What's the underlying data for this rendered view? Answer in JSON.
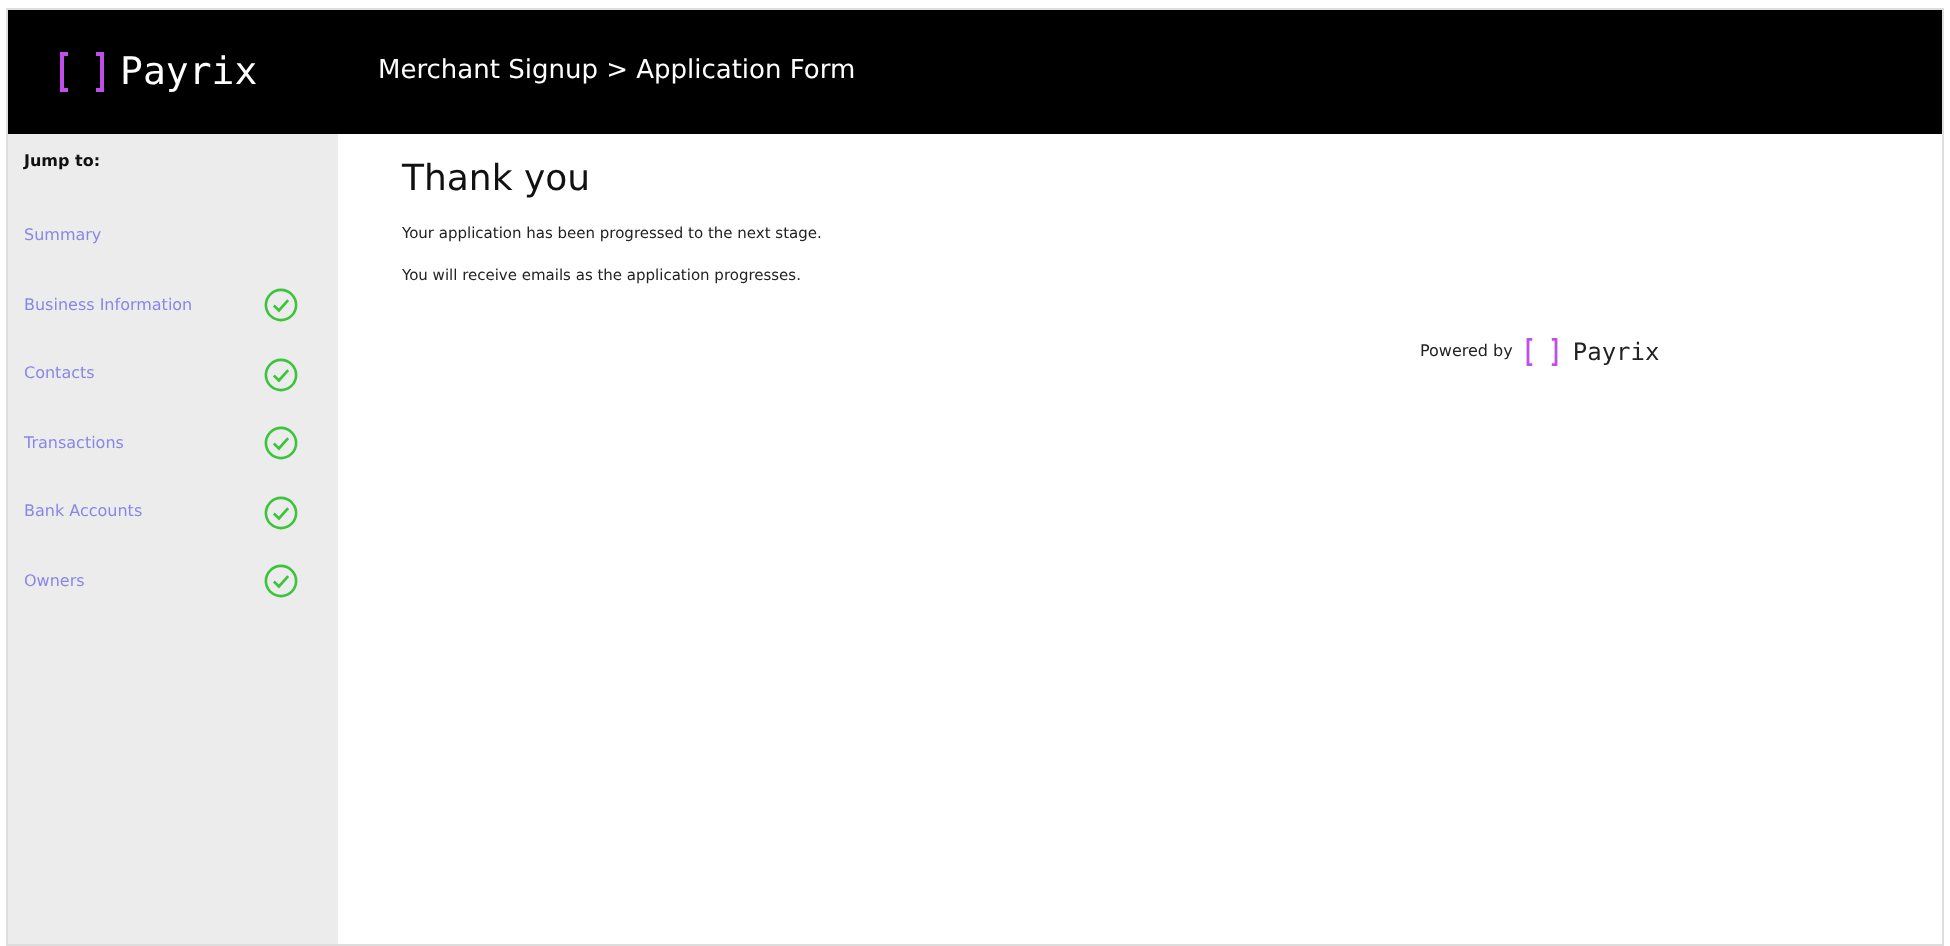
{
  "header": {
    "brand": "Payrix",
    "breadcrumb": "Merchant Signup > Application Form"
  },
  "sidebar": {
    "heading": "Jump to:",
    "items": [
      {
        "label": "Summary",
        "completed": false
      },
      {
        "label": "Business Information",
        "completed": true
      },
      {
        "label": "Contacts",
        "completed": true
      },
      {
        "label": "Transactions",
        "completed": true
      },
      {
        "label": "Bank Accounts",
        "completed": true
      },
      {
        "label": "Owners",
        "completed": true
      }
    ]
  },
  "main": {
    "title": "Thank you",
    "messages": [
      "Your application has been progressed to the next stage.",
      "You will receive emails as the application progresses."
    ],
    "footer": {
      "powered_by": "Powered by",
      "brand": "Payrix"
    }
  }
}
